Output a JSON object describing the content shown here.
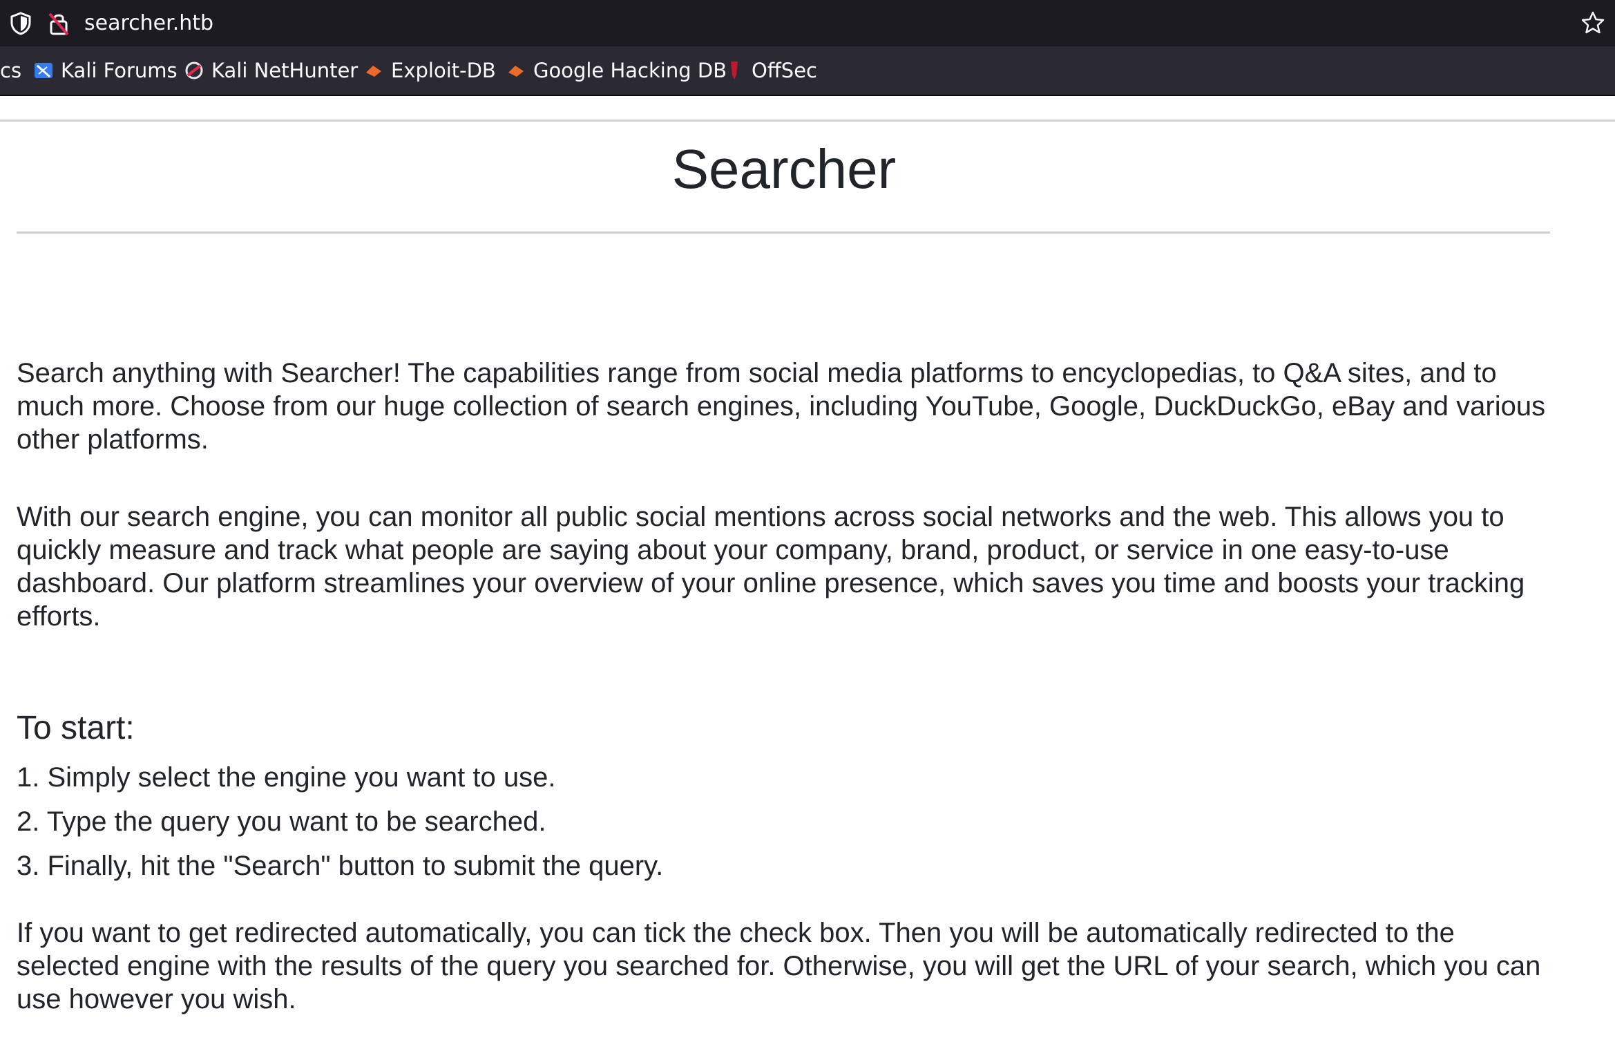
{
  "browser": {
    "url": "searcher.htb",
    "bookmarks": [
      {
        "label": "cs",
        "icon": "truncated-bookmark"
      },
      {
        "label": "Kali Forums",
        "icon": "kali-forums-icon"
      },
      {
        "label": "Kali NetHunter",
        "icon": "kali-nethunter-icon"
      },
      {
        "label": "Exploit-DB",
        "icon": "exploit-db-icon"
      },
      {
        "label": "Google Hacking DB",
        "icon": "google-hacking-db-icon"
      },
      {
        "label": "OffSec",
        "icon": "offsec-icon"
      }
    ]
  },
  "page": {
    "title": "Searcher",
    "intro_p1": "Search anything with Searcher! The capabilities range from social media platforms to encyclopedias, to Q&A sites, and to much more. Choose from our huge collection of search engines, including YouTube, Google, DuckDuckGo, eBay and various other platforms.",
    "intro_p2": "With our search engine, you can monitor all public social mentions across social networks and the web. This allows you to quickly measure and track what people are saying about your company, brand, product, or service in one easy-to-use dashboard. Our platform streamlines your overview of your online presence, which saves you time and boosts your tracking efforts.",
    "start_heading": "To start:",
    "steps": [
      "1. Simply select the engine you want to use.",
      "2. Type the query you want to be searched.",
      "3. Finally, hit the \"Search\" button to submit the query."
    ],
    "redirect_note": "If you want to get redirected automatically, you can tick the check box. Then you will be automatically redirected to the selected engine with the results of the query you searched for. Otherwise, you will get the URL of your search, which you can use however you wish."
  }
}
